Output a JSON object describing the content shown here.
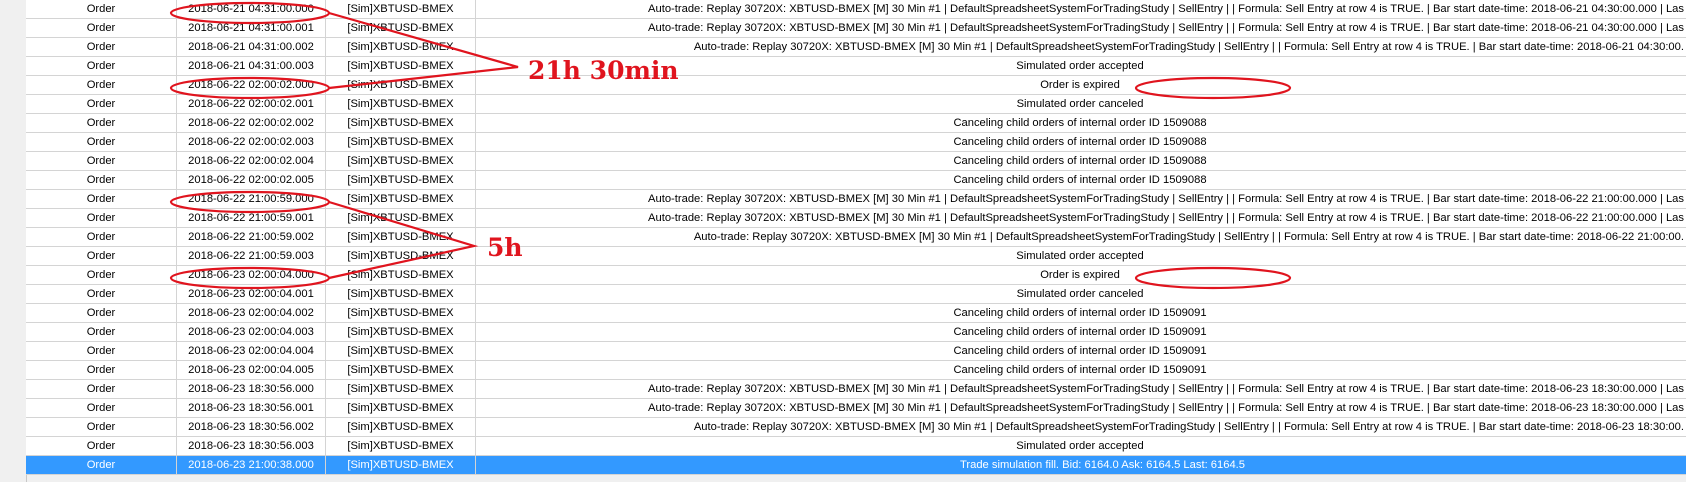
{
  "log": {
    "rows": [
      {
        "type": "Order",
        "datetime": "2018-06-21 04:31:00.000",
        "symbol": "[Sim]XBTUSD-BMEX",
        "message": "Auto-trade: Replay 30720X: XBTUSD-BMEX [M]  30 Min   #1 | DefaultSpreadsheetSystemForTradingStudy | SellEntry |  | Formula: Sell Entry at row 4 is TRUE. | Bar start date-time: 2018-06-21  04:30:00.000 | Las",
        "align": "right"
      },
      {
        "type": "Order",
        "datetime": "2018-06-21 04:31:00.001",
        "symbol": "[Sim]XBTUSD-BMEX",
        "message": "Auto-trade: Replay 30720X: XBTUSD-BMEX [M]  30 Min   #1 | DefaultSpreadsheetSystemForTradingStudy | SellEntry |  | Formula: Sell Entry at row 4 is TRUE. | Bar start date-time: 2018-06-21  04:30:00.000 | Las",
        "align": "right"
      },
      {
        "type": "Order",
        "datetime": "2018-06-21 04:31:00.002",
        "symbol": "[Sim]XBTUSD-BMEX",
        "message": "Auto-trade: Replay 30720X: XBTUSD-BMEX [M]  30 Min   #1 | DefaultSpreadsheetSystemForTradingStudy | SellEntry |  | Formula: Sell Entry at row 4 is TRUE. | Bar start date-time: 2018-06-21  04:30:00.",
        "align": "right"
      },
      {
        "type": "Order",
        "datetime": "2018-06-21 04:31:00.003",
        "symbol": "[Sim]XBTUSD-BMEX",
        "message": "Simulated order accepted",
        "align": "center"
      },
      {
        "type": "Order",
        "datetime": "2018-06-22 02:00:02.000",
        "symbol": "[Sim]XBTUSD-BMEX",
        "message": "Order is expired",
        "align": "center"
      },
      {
        "type": "Order",
        "datetime": "2018-06-22 02:00:02.001",
        "symbol": "[Sim]XBTUSD-BMEX",
        "message": "Simulated order canceled",
        "align": "center"
      },
      {
        "type": "Order",
        "datetime": "2018-06-22 02:00:02.002",
        "symbol": "[Sim]XBTUSD-BMEX",
        "message": "Canceling child orders of internal order ID 1509088",
        "align": "center"
      },
      {
        "type": "Order",
        "datetime": "2018-06-22 02:00:02.003",
        "symbol": "[Sim]XBTUSD-BMEX",
        "message": "Canceling child orders of internal order ID 1509088",
        "align": "center"
      },
      {
        "type": "Order",
        "datetime": "2018-06-22 02:00:02.004",
        "symbol": "[Sim]XBTUSD-BMEX",
        "message": "Canceling child orders of internal order ID 1509088",
        "align": "center"
      },
      {
        "type": "Order",
        "datetime": "2018-06-22 02:00:02.005",
        "symbol": "[Sim]XBTUSD-BMEX",
        "message": "Canceling child orders of internal order ID 1509088",
        "align": "center"
      },
      {
        "type": "Order",
        "datetime": "2018-06-22 21:00:59.000",
        "symbol": "[Sim]XBTUSD-BMEX",
        "message": "Auto-trade: Replay 30720X: XBTUSD-BMEX [M]  30 Min   #1 | DefaultSpreadsheetSystemForTradingStudy | SellEntry |  | Formula: Sell Entry at row 4 is TRUE. | Bar start date-time: 2018-06-22  21:00:00.000 | Las",
        "align": "right"
      },
      {
        "type": "Order",
        "datetime": "2018-06-22 21:00:59.001",
        "symbol": "[Sim]XBTUSD-BMEX",
        "message": "Auto-trade: Replay 30720X: XBTUSD-BMEX [M]  30 Min   #1 | DefaultSpreadsheetSystemForTradingStudy | SellEntry |  | Formula: Sell Entry at row 4 is TRUE. | Bar start date-time: 2018-06-22  21:00:00.000 | Las",
        "align": "right"
      },
      {
        "type": "Order",
        "datetime": "2018-06-22 21:00:59.002",
        "symbol": "[Sim]XBTUSD-BMEX",
        "message": "Auto-trade: Replay 30720X: XBTUSD-BMEX [M]  30 Min   #1 | DefaultSpreadsheetSystemForTradingStudy | SellEntry |  | Formula: Sell Entry at row 4 is TRUE. | Bar start date-time: 2018-06-22  21:00:00.",
        "align": "right"
      },
      {
        "type": "Order",
        "datetime": "2018-06-22 21:00:59.003",
        "symbol": "[Sim]XBTUSD-BMEX",
        "message": "Simulated order accepted",
        "align": "center"
      },
      {
        "type": "Order",
        "datetime": "2018-06-23 02:00:04.000",
        "symbol": "[Sim]XBTUSD-BMEX",
        "message": "Order is expired",
        "align": "center"
      },
      {
        "type": "Order",
        "datetime": "2018-06-23 02:00:04.001",
        "symbol": "[Sim]XBTUSD-BMEX",
        "message": "Simulated order canceled",
        "align": "center"
      },
      {
        "type": "Order",
        "datetime": "2018-06-23 02:00:04.002",
        "symbol": "[Sim]XBTUSD-BMEX",
        "message": "Canceling child orders of internal order ID 1509091",
        "align": "center"
      },
      {
        "type": "Order",
        "datetime": "2018-06-23 02:00:04.003",
        "symbol": "[Sim]XBTUSD-BMEX",
        "message": "Canceling child orders of internal order ID 1509091",
        "align": "center"
      },
      {
        "type": "Order",
        "datetime": "2018-06-23 02:00:04.004",
        "symbol": "[Sim]XBTUSD-BMEX",
        "message": "Canceling child orders of internal order ID 1509091",
        "align": "center"
      },
      {
        "type": "Order",
        "datetime": "2018-06-23 02:00:04.005",
        "symbol": "[Sim]XBTUSD-BMEX",
        "message": "Canceling child orders of internal order ID 1509091",
        "align": "center"
      },
      {
        "type": "Order",
        "datetime": "2018-06-23 18:30:56.000",
        "symbol": "[Sim]XBTUSD-BMEX",
        "message": "Auto-trade: Replay 30720X: XBTUSD-BMEX [M]  30 Min   #1 | DefaultSpreadsheetSystemForTradingStudy | SellEntry |  | Formula: Sell Entry at row 4 is TRUE. | Bar start date-time: 2018-06-23  18:30:00.000 | Las",
        "align": "right"
      },
      {
        "type": "Order",
        "datetime": "2018-06-23 18:30:56.001",
        "symbol": "[Sim]XBTUSD-BMEX",
        "message": "Auto-trade: Replay 30720X: XBTUSD-BMEX [M]  30 Min   #1 | DefaultSpreadsheetSystemForTradingStudy | SellEntry |  | Formula: Sell Entry at row 4 is TRUE. | Bar start date-time: 2018-06-23  18:30:00.000 | Las",
        "align": "right"
      },
      {
        "type": "Order",
        "datetime": "2018-06-23 18:30:56.002",
        "symbol": "[Sim]XBTUSD-BMEX",
        "message": "Auto-trade: Replay 30720X: XBTUSD-BMEX [M]  30 Min   #1 | DefaultSpreadsheetSystemForTradingStudy | SellEntry |  | Formula: Sell Entry at row 4 is TRUE. | Bar start date-time: 2018-06-23  18:30:00.",
        "align": "right"
      },
      {
        "type": "Order",
        "datetime": "2018-06-23 18:30:56.003",
        "symbol": "[Sim]XBTUSD-BMEX",
        "message": "Simulated order accepted",
        "align": "center"
      },
      {
        "type": "Order",
        "datetime": "2018-06-23 21:00:38.000",
        "symbol": "[Sim]XBTUSD-BMEX",
        "message": "Trade simulation fill. Bid: 6164.0 Ask: 6164.5 Last: 6164.5",
        "align": "fill",
        "selected": true
      }
    ]
  },
  "annotations": {
    "label_1": "21h 30min",
    "label_2": "5h",
    "color": "#e0141e"
  },
  "colors": {
    "selected_row": "#3399ff",
    "grid_line": "#d4d4d4"
  }
}
